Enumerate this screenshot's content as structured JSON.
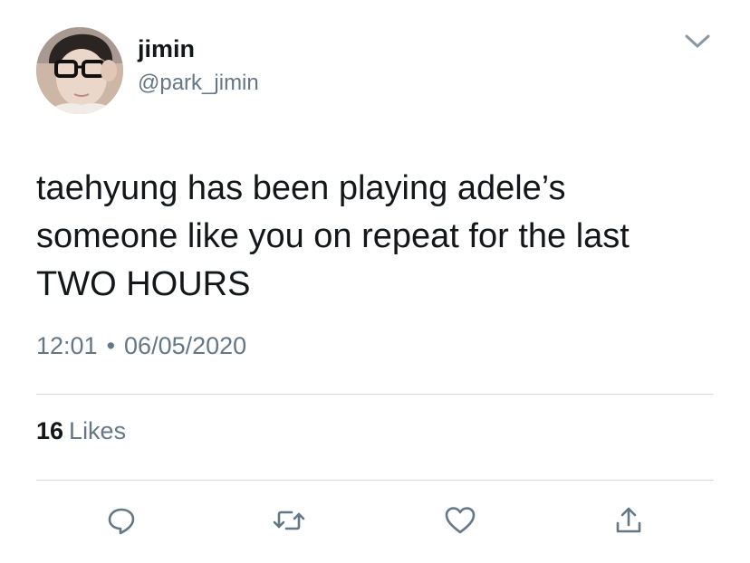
{
  "user": {
    "display_name": "jimin",
    "handle": "@park_jimin",
    "avatar_icon": "profile-photo"
  },
  "tweet": {
    "lines": [
      "taehyung has been playing adele’s",
      "someone like you on repeat for the last",
      "TWO HOURS"
    ]
  },
  "meta": {
    "time": "12:01",
    "separator": "•",
    "date": "06/05/2020"
  },
  "stats": {
    "likes_count": "16",
    "likes_label": "Likes"
  },
  "actions": [
    {
      "icon": "reply-icon"
    },
    {
      "icon": "retweet-icon"
    },
    {
      "icon": "heart-icon"
    },
    {
      "icon": "share-icon"
    }
  ],
  "colors": {
    "text": "#14171a",
    "secondary": "#657786",
    "divider": "#d5dbe0",
    "icon": "#657786"
  }
}
